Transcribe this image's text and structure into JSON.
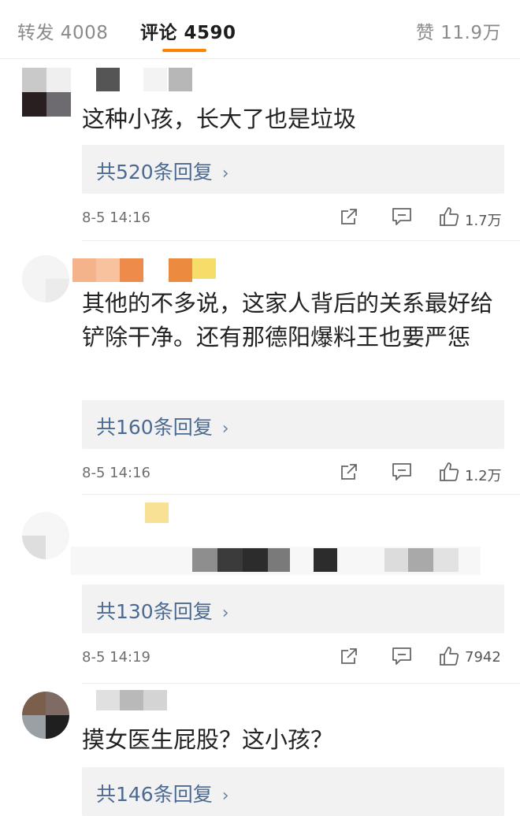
{
  "tabs": {
    "repost": "转发 4008",
    "comments": "评论 4590",
    "likes": "赞 11.9万"
  },
  "colors": {
    "accent": "#ff8200",
    "link": "#4c6a91",
    "reply_bg": "#f2f2f2"
  },
  "comments": [
    {
      "text": "这种小孩，长大了也是垃圾",
      "replies_label": "共520条回复",
      "time": "8-5 14:16",
      "likes": "1.7万"
    },
    {
      "text": "其他的不多说，这家人背后的关系最好给铲除干净。还有那德阳爆料王也要严惩",
      "replies_label": "共160条回复",
      "time": "8-5 14:16",
      "likes": "1.2万"
    },
    {
      "text": "",
      "replies_label": "共130条回复",
      "time": "8-5 14:19",
      "likes": "7942"
    },
    {
      "text": "摸女医生屁股？这小孩？",
      "replies_label": "共146条回复",
      "time": "",
      "likes": ""
    }
  ],
  "icons": {
    "share": "share-icon",
    "reply": "comment-icon",
    "like": "thumbs-up-icon",
    "chevron": "chevron-right-icon"
  }
}
